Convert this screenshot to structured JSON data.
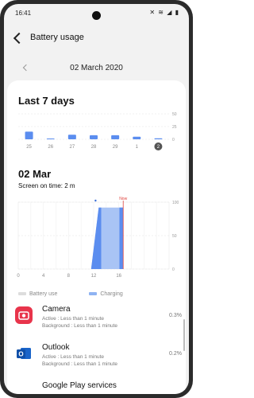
{
  "status": {
    "time": "16:41",
    "icons": "✕ ≋ ◢ ▮"
  },
  "appbar": {
    "title": "Battery usage"
  },
  "date_nav": {
    "date": "02 March 2020"
  },
  "weekly": {
    "title": "Last 7 days",
    "chart_data": {
      "type": "bar",
      "categories": [
        "25",
        "26",
        "27",
        "28",
        "29",
        "1",
        "2"
      ],
      "values": [
        15,
        1,
        9,
        8,
        8,
        5,
        2
      ],
      "ylim": [
        0,
        50
      ],
      "yticks": [
        "50",
        "25",
        "0"
      ],
      "selected": "2",
      "color": "#5b8def"
    }
  },
  "daily": {
    "title": "02 Mar",
    "screen_on_time": "Screen on time: 2 m",
    "now_label": "Now",
    "chart_data": {
      "type": "area",
      "xticks": [
        "0",
        "4",
        "8",
        "12",
        "16"
      ],
      "xlim": [
        0,
        24
      ],
      "yticks": [
        "100",
        "50",
        "0"
      ],
      "ylim": [
        0,
        100
      ],
      "battery_color": "#5b8def",
      "charging_color": "#a9c4f5",
      "now_hour": 16.7
    }
  },
  "legend": {
    "battery_use": "Battery use",
    "charging": "Charging"
  },
  "apps": [
    {
      "name": "Camera",
      "active": "Active : Less than 1 minute",
      "background": "Background : Less than 1 minute",
      "percent": "0.3%",
      "icon_color": "#e8344b"
    },
    {
      "name": "Outlook",
      "active": "Active : Less than 1 minute",
      "background": "Background : Less than 1 minute",
      "percent": "0.2%",
      "icon_color": "#1a64c9"
    },
    {
      "name": "Google Play services",
      "active": "",
      "background": "",
      "percent": "",
      "icon_color": "#ffffff"
    }
  ]
}
